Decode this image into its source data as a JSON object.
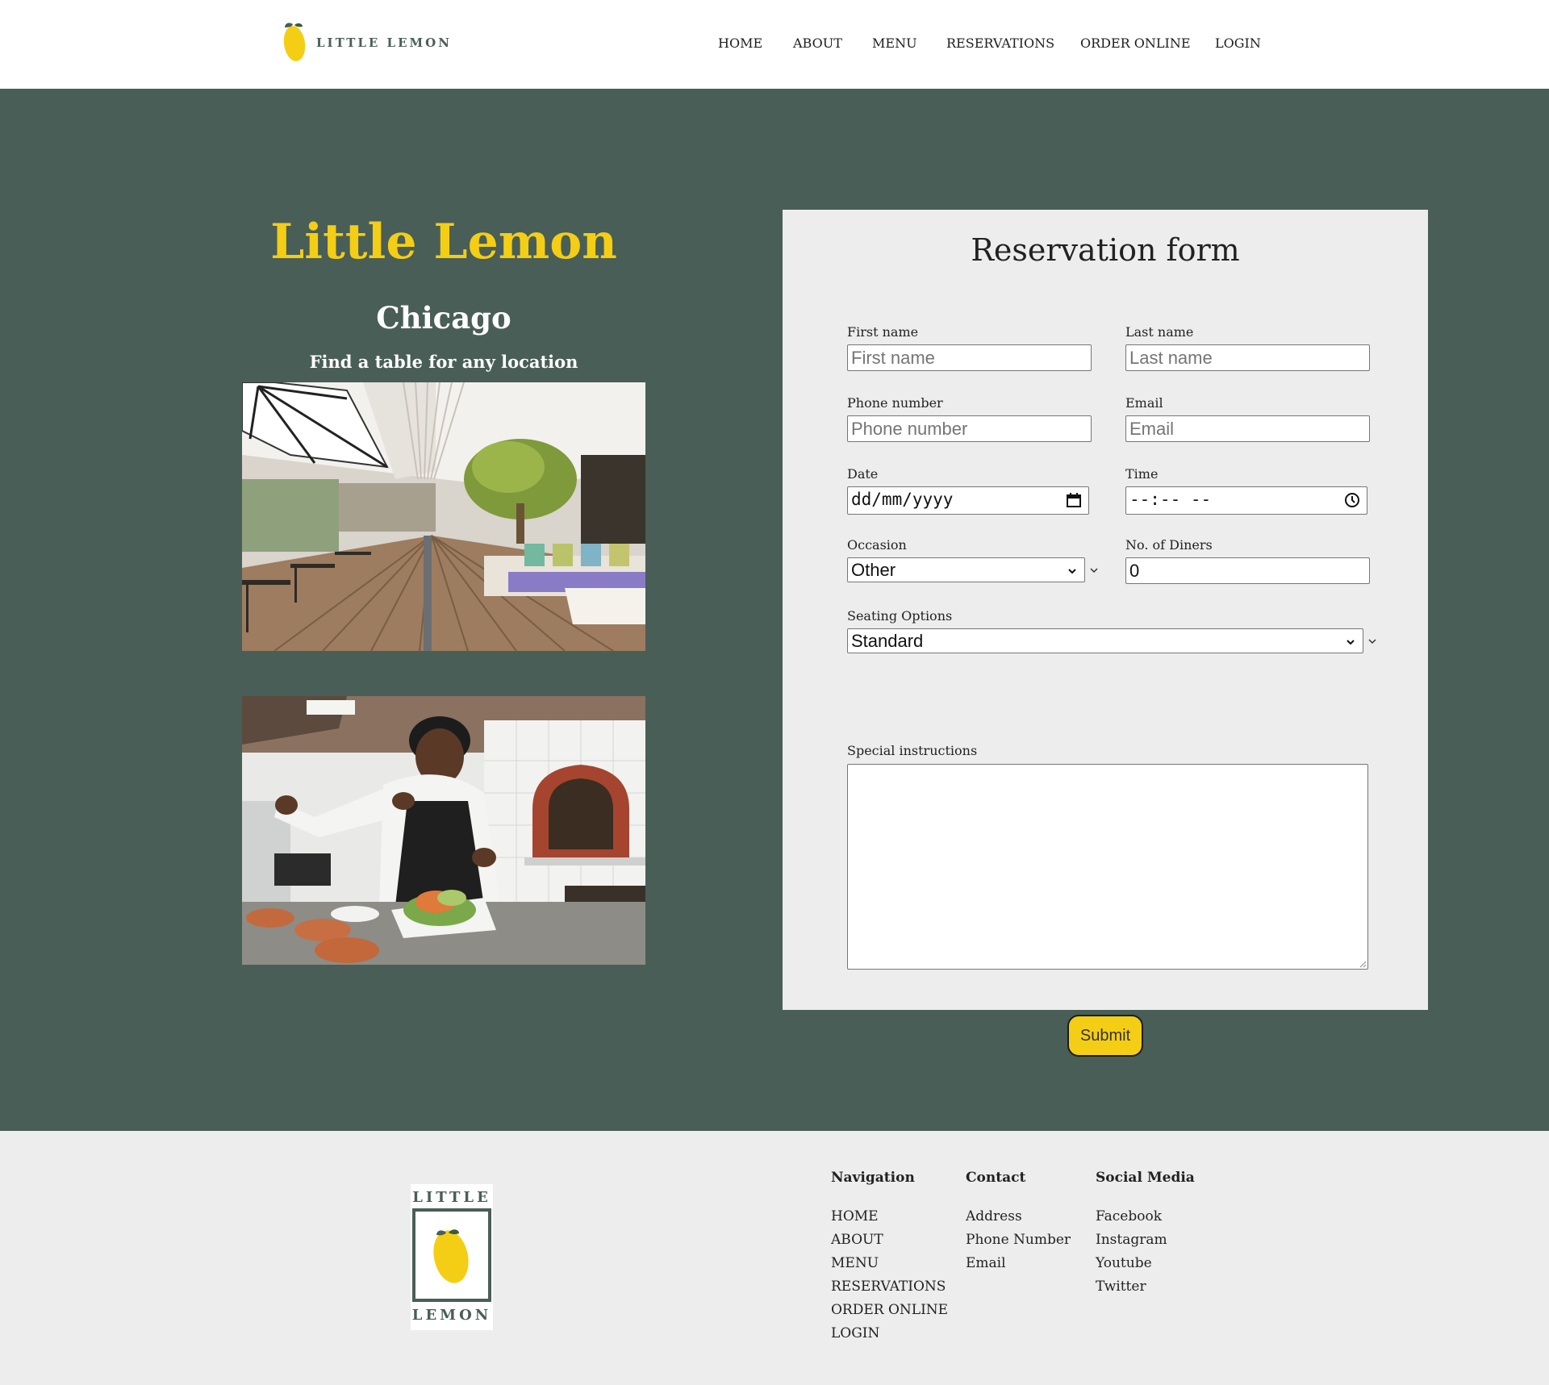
{
  "brand": {
    "name": "LITTLE LEMON",
    "logo_top": "LITTLE",
    "logo_bottom": "LEMON",
    "colors": {
      "green": "#495e57",
      "yellow": "#f4ce14",
      "light": "#ecedec"
    }
  },
  "nav": {
    "items": [
      "HOME",
      "ABOUT",
      "MENU",
      "RESERVATIONS",
      "ORDER ONLINE",
      "LOGIN"
    ]
  },
  "hero": {
    "title": "Little Lemon",
    "city": "Chicago",
    "subtitle": "Find a table for any location",
    "images": [
      "restaurant-terrace-photo",
      "chef-plating-photo"
    ]
  },
  "form": {
    "title": "Reservation form",
    "first_name": {
      "label": "First name",
      "placeholder": "First name"
    },
    "last_name": {
      "label": "Last name",
      "placeholder": "Last name"
    },
    "phone": {
      "label": "Phone number",
      "placeholder": "Phone number"
    },
    "email": {
      "label": "Email",
      "placeholder": "Email"
    },
    "date": {
      "label": "Date",
      "value": "dd/mm/yyyy",
      "icon": "calendar-icon"
    },
    "time": {
      "label": "Time",
      "value": "--:-- --",
      "icon": "clock-icon"
    },
    "occasion": {
      "label": "Occasion",
      "selected": "Other"
    },
    "diners": {
      "label": "No. of Diners",
      "value": "0"
    },
    "seating": {
      "label": "Seating Options",
      "selected": "Standard"
    },
    "instructions": {
      "label": "Special instructions"
    },
    "submit_label": "Submit"
  },
  "footer": {
    "navigation": {
      "heading": "Navigation",
      "items": [
        "HOME",
        "ABOUT",
        "MENU",
        "RESERVATIONS",
        "ORDER ONLINE",
        "LOGIN"
      ]
    },
    "contact": {
      "heading": "Contact",
      "items": [
        "Address",
        "Phone Number",
        "Email"
      ]
    },
    "social": {
      "heading": "Social Media",
      "items": [
        "Facebook",
        "Instagram",
        "Youtube",
        "Twitter"
      ]
    }
  }
}
